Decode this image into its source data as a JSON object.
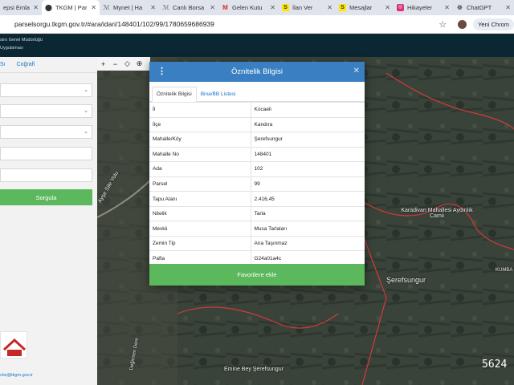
{
  "browser": {
    "tabs": [
      {
        "label": "epsi Emla",
        "icon": "globe-icon",
        "active": false
      },
      {
        "label": "TKGM | Par",
        "icon": "location-pin-icon",
        "active": true
      },
      {
        "label": "Mynet | Ha",
        "icon": "mynet-icon",
        "active": false
      },
      {
        "label": "Canlı Borsa",
        "icon": "mynet-icon",
        "active": false
      },
      {
        "label": "Gelen Kutu",
        "icon": "gmail-icon",
        "active": false
      },
      {
        "label": "İlan Ver",
        "icon": "sahibinden-icon",
        "active": false
      },
      {
        "label": "Mesajlar",
        "icon": "sahibinden-icon",
        "active": false
      },
      {
        "label": "Hikayeler",
        "icon": "instagram-icon",
        "active": false
      },
      {
        "label": "ChatGPT",
        "icon": "chatgpt-icon",
        "active": false
      }
    ],
    "url": "parselsorgu.tkgm.gov.tr/#ara/idari/148401/102/99/1780659686939",
    "new_chrome_label": "Yeni Chrom"
  },
  "app": {
    "header_line1": "stro Genel Müdürlüğü",
    "header_line2": "Uygulaması"
  },
  "left_panel": {
    "tab_1": "Sı",
    "tab_2": "Coğrafi",
    "query_button": "Sorgula",
    "contact_email": "cbs@tkgm.gov.tr"
  },
  "map": {
    "labels": {
      "road": "Ayşe Sile Yolu",
      "village_mosque": "Karadivan Mahallesi Aydınlık Camii",
      "village": "Şerefsungur",
      "street_bottom": "Emine Bey Şerefsungur",
      "right_edge": "KUMBA",
      "road_left": "Değirmen Dere"
    },
    "scale_readout": "5624"
  },
  "modal": {
    "title": "Öznitelik Bilgisi",
    "tab_active": "Öznitelik Bilgisi",
    "tab_other": "Bina/BB Listesi",
    "rows": [
      {
        "key": "İl",
        "value": "Kocaeli"
      },
      {
        "key": "İlçe",
        "value": "Kandıra"
      },
      {
        "key": "Mahalle/Köy",
        "value": "Şerefsungur"
      },
      {
        "key": "Mahalle No",
        "value": "148401"
      },
      {
        "key": "Ada",
        "value": "102"
      },
      {
        "key": "Parsel",
        "value": "99"
      },
      {
        "key": "Tapu Alanı",
        "value": "2.416,45"
      },
      {
        "key": "Nitelik",
        "value": "Tarla"
      },
      {
        "key": "Mevkii",
        "value": "Musa Tarlaları"
      },
      {
        "key": "Zemin Tip",
        "value": "Ana Taşınmaz"
      },
      {
        "key": "Pafta",
        "value": "G24a01a4c"
      }
    ],
    "favorite_button": "Favorilere ekle"
  },
  "colors": {
    "header_blue": "#3a7fc1",
    "button_green": "#5cb85c",
    "parcel_border": "#d33a3a"
  }
}
